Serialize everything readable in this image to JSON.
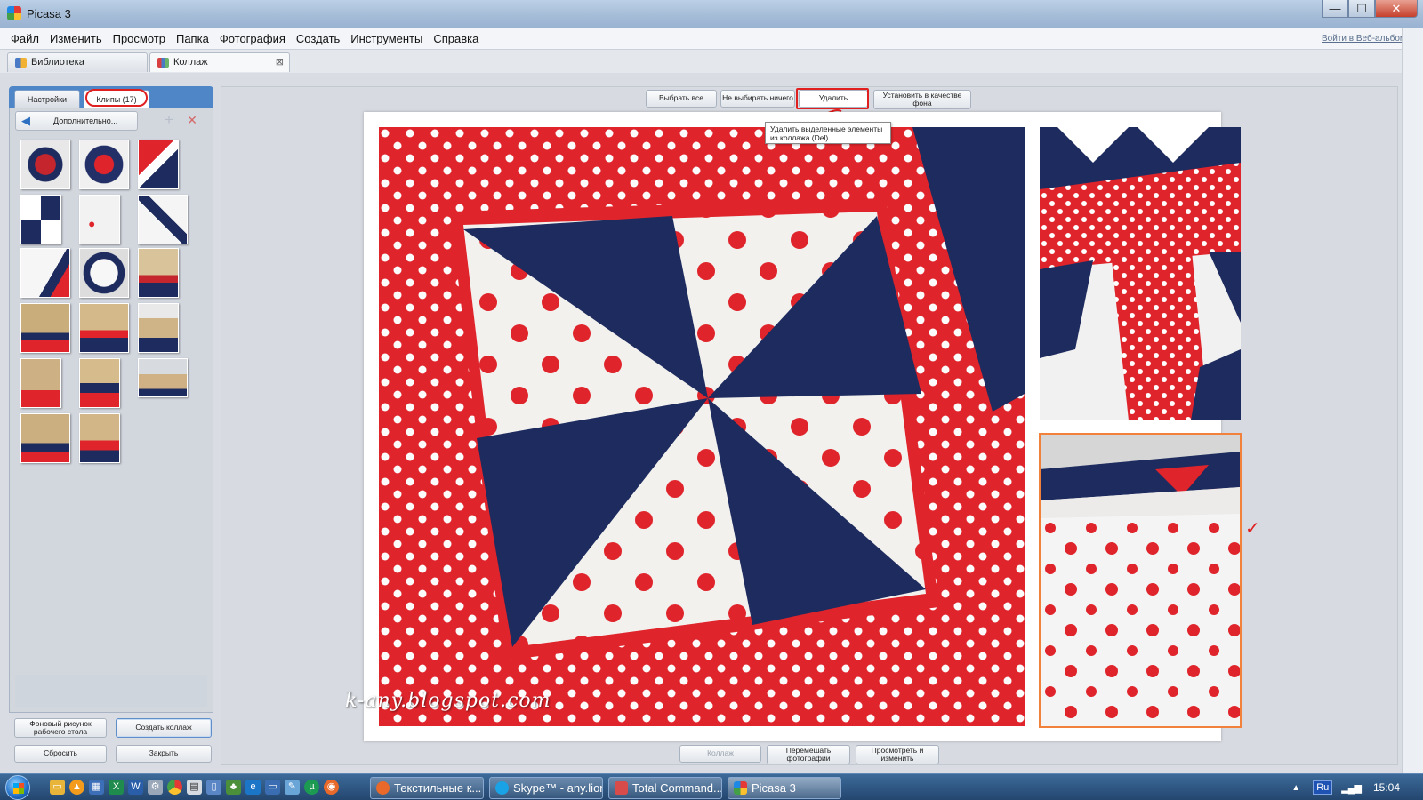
{
  "window": {
    "title": "Picasa 3",
    "minimize_label": "—",
    "maximize_label": "☐",
    "close_label": "✕"
  },
  "menu": {
    "items": [
      "Файл",
      "Изменить",
      "Просмотр",
      "Папка",
      "Фотография",
      "Создать",
      "Инструменты",
      "Справка"
    ],
    "weblogin": "Войти в Веб-альбомы"
  },
  "tabs": [
    {
      "label": "Библиотека"
    },
    {
      "label": "Коллаж",
      "close": "⊠"
    }
  ],
  "left_panel": {
    "tabs": [
      "Настройки",
      "Клипы (17)"
    ],
    "back_label": "Дополнительно...",
    "add_icon": "+",
    "remove_icon": "✕",
    "buttons": {
      "wallpaper": "Фоновый рисунок рабочего стола",
      "create": "Создать коллаж",
      "reset": "Сбросить",
      "close": "Закрыть"
    }
  },
  "toolbar": {
    "select_all": "Выбрать все",
    "select_none": "Не выбирать ничего",
    "delete": "Удалить",
    "set_background": "Установить в качестве фона"
  },
  "tooltip": {
    "text": "Удалить выделенные элементы из коллажа (Del)"
  },
  "canvas": {
    "watermark": "k-any.blogspot.com"
  },
  "bottom_toolbar": {
    "collage": "Коллаж",
    "shuffle": "Перемешать фотографии",
    "view_edit": "Просмотреть и изменить"
  },
  "taskbar": {
    "tasks": [
      "Текстильные к...",
      "Skype™ - any.lion",
      "Total Command...",
      "Picasa 3"
    ],
    "language": "Ru",
    "clock": "15:04"
  },
  "colors": {
    "accent": "#4f86c7",
    "annotation_red": "#e02020",
    "selection_orange": "#f2813b",
    "fabric_red": "#e0242b",
    "fabric_navy": "#1d2b5e"
  }
}
